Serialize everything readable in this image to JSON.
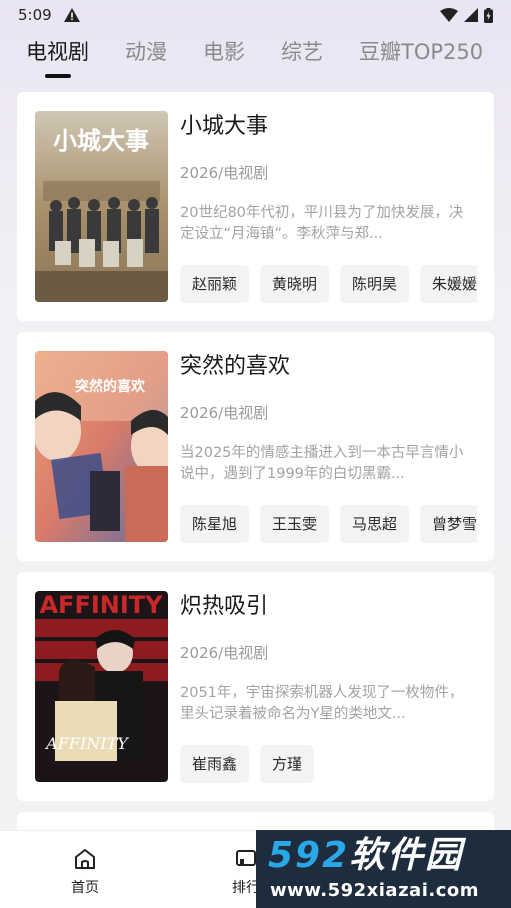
{
  "status": {
    "time": "5:09"
  },
  "tabs": [
    {
      "label": "电视剧",
      "active": true
    },
    {
      "label": "动漫",
      "active": false
    },
    {
      "label": "电影",
      "active": false
    },
    {
      "label": "综艺",
      "active": false
    },
    {
      "label": "豆瓣TOP250",
      "active": false
    }
  ],
  "cards": [
    {
      "title": "小城大事",
      "meta": "2026/电视剧",
      "desc": "20世纪80年代初，平川县为了加快发展，决定设立“月海镇”。李秋萍与郑...",
      "poster_text": "小城大事",
      "tags": [
        "赵丽颖",
        "黄晓明",
        "陈明昊",
        "朱媛媛"
      ]
    },
    {
      "title": "突然的喜欢",
      "meta": "2026/电视剧",
      "desc": "当2025年的情感主播进入到一本古早言情小说中，遇到了1999年的白切黑霸...",
      "poster_text": "突然的喜欢",
      "tags": [
        "陈星旭",
        "王玉雯",
        "马思超",
        "曾梦雪"
      ]
    },
    {
      "title": "炽热吸引",
      "meta": "2026/电视剧",
      "desc": "2051年，宇宙探索机器人发现了一枚物件，里头记录着被命名为Y星的类地文...",
      "poster_text": "AFFINITY",
      "tags": [
        "崔雨鑫",
        "方瑾"
      ]
    }
  ],
  "bottom_nav": {
    "home_label": "首页",
    "rank_label": "排行"
  },
  "watermark": {
    "brand_num": "592",
    "brand_text": "软件园",
    "url": "www.592xiazai.com"
  },
  "colors": {
    "accent": "#111111",
    "tag_bg": "#f3f3f3",
    "watermark_bg": "#1e2d3e",
    "watermark_num": "#29a7e6"
  }
}
